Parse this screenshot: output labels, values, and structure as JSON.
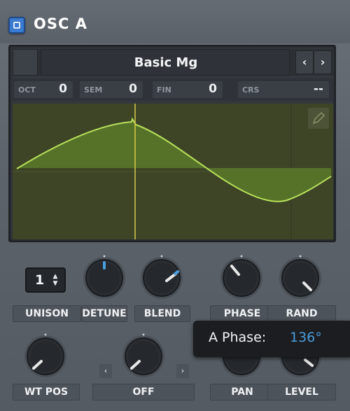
{
  "header": {
    "title": "OSC A"
  },
  "wavetable": {
    "name": "Basic Mg",
    "prev_label": "‹",
    "next_label": "›"
  },
  "pitch": {
    "oct": {
      "label": "OCT",
      "value": "0"
    },
    "sem": {
      "label": "SEM",
      "value": "0"
    },
    "fin": {
      "label": "FIN",
      "value": "0"
    },
    "crs": {
      "label": "CRS",
      "value": "--"
    }
  },
  "controls": {
    "unison": {
      "label": "UNISON",
      "value": "1"
    },
    "detune": {
      "label": "DETUNE"
    },
    "blend": {
      "label": "BLEND"
    },
    "phase": {
      "label": "PHASE"
    },
    "rand": {
      "label": "RAND"
    },
    "wt_pos": {
      "label": "WT POS"
    },
    "warp": {
      "label": "OFF"
    },
    "pan": {
      "label": "PAN"
    },
    "level": {
      "label": "LEVEL"
    }
  },
  "tooltip": {
    "label": "A Phase:",
    "value": "136°"
  },
  "colors": {
    "accent": "#4a9ede",
    "wave_line": "#b8e05a",
    "wave_fill": "#5a7a2a",
    "playhead": "#d8c84a"
  }
}
